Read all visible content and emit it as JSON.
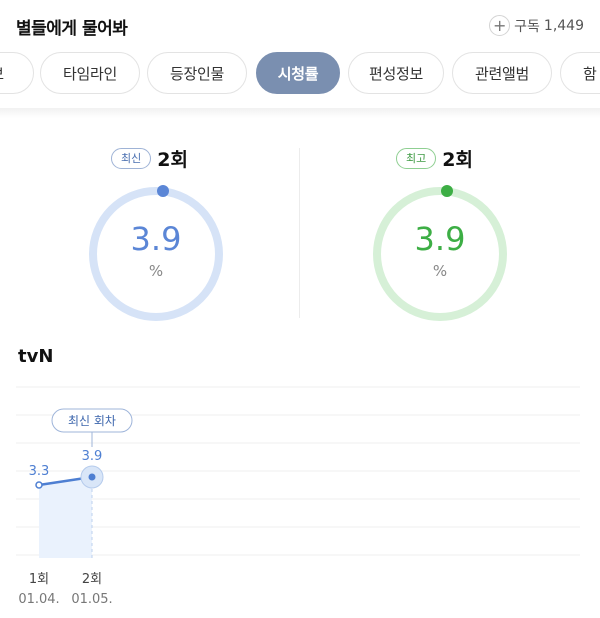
{
  "header": {
    "title": "별들에게 물어봐",
    "subscribe_label": "구독",
    "subscribe_count": "1,449"
  },
  "tabs": [
    {
      "label": "보",
      "active": false
    },
    {
      "label": "타임라인",
      "active": false
    },
    {
      "label": "등장인물",
      "active": false
    },
    {
      "label": "시청률",
      "active": true
    },
    {
      "label": "편성정보",
      "active": false
    },
    {
      "label": "관련앨범",
      "active": false
    },
    {
      "label": "함",
      "active": false
    }
  ],
  "gauges": [
    {
      "badge": "최신",
      "episode": "2회",
      "value": "3.9",
      "unit": "%",
      "color": "#5b86d6",
      "track": "#d6e3f7"
    },
    {
      "badge": "최고",
      "episode": "2회",
      "value": "3.9",
      "unit": "%",
      "color": "#3dae45",
      "track": "#d6f0d7"
    }
  ],
  "network": "tvN",
  "chart_data": {
    "type": "line",
    "callout": "최신 회차",
    "x": [
      {
        "episode": "1회",
        "date": "01.04."
      },
      {
        "episode": "2회",
        "date": "01.05."
      }
    ],
    "series": [
      {
        "values": [
          3.3,
          3.9
        ]
      }
    ],
    "value_labels": [
      "3.3",
      "3.9"
    ],
    "latest_index": 1,
    "grid": true
  }
}
